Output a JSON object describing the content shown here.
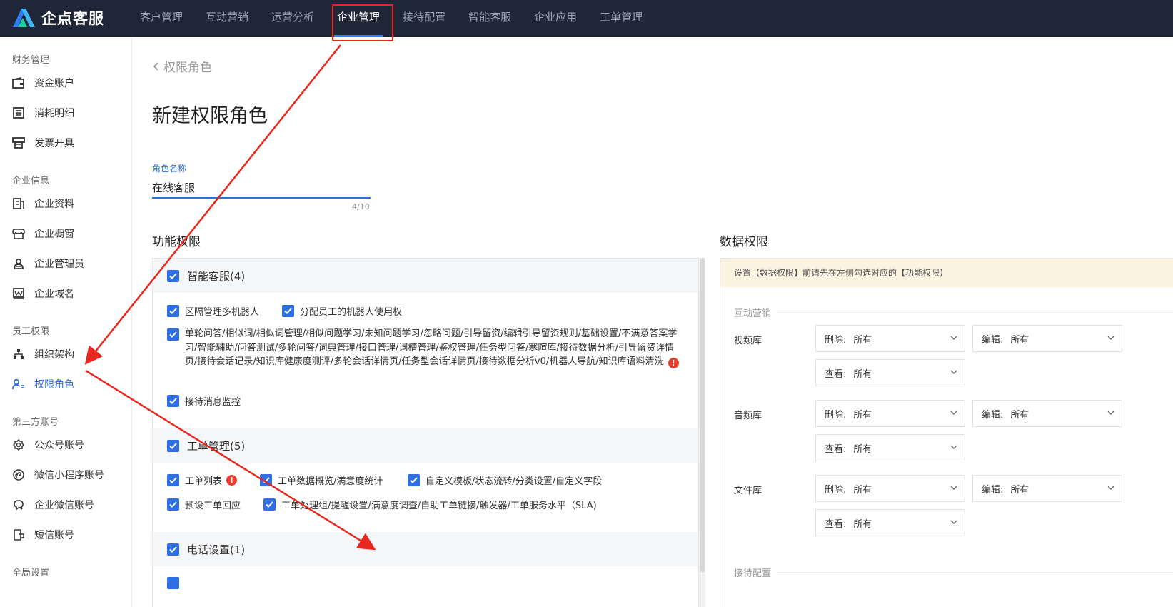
{
  "brand": {
    "name": "企点客服"
  },
  "nav": [
    {
      "label": "客户管理",
      "active": false
    },
    {
      "label": "互动营销",
      "active": false
    },
    {
      "label": "运营分析",
      "active": false
    },
    {
      "label": "企业管理",
      "active": true
    },
    {
      "label": "接待配置",
      "active": false
    },
    {
      "label": "智能客服",
      "active": false
    },
    {
      "label": "企业应用",
      "active": false
    },
    {
      "label": "工单管理",
      "active": false
    }
  ],
  "sidebar": {
    "groups": [
      {
        "title": "财务管理"
      },
      {
        "title": "企业信息"
      },
      {
        "title": "员工权限"
      },
      {
        "title": "第三方账号"
      },
      {
        "title": "全局设置"
      }
    ],
    "items": [
      {
        "label": "资金账户",
        "icon": "wallet-icon"
      },
      {
        "label": "消耗明细",
        "icon": "list-icon"
      },
      {
        "label": "发票开具",
        "icon": "invoice-icon"
      },
      {
        "label": "企业资料",
        "icon": "document-icon"
      },
      {
        "label": "企业橱窗",
        "icon": "storefront-icon"
      },
      {
        "label": "企业管理员",
        "icon": "user-icon"
      },
      {
        "label": "企业域名",
        "icon": "domain-icon"
      },
      {
        "label": "组织架构",
        "icon": "org-chart-icon"
      },
      {
        "label": "权限角色",
        "icon": "role-icon",
        "active": true
      },
      {
        "label": "公众号账号",
        "icon": "official-account-icon"
      },
      {
        "label": "微信小程序账号",
        "icon": "mini-program-icon"
      },
      {
        "label": "企业微信账号",
        "icon": "wecom-icon"
      },
      {
        "label": "短信账号",
        "icon": "sms-icon"
      }
    ]
  },
  "main": {
    "back_label": "权限角色",
    "title": "新建权限角色",
    "role_name": {
      "label": "角色名称",
      "value": "在线客服",
      "count": "4/10"
    },
    "func_title": "功能权限",
    "data_title": "数据权限"
  },
  "func_groups": [
    {
      "title": "智能客服(4)",
      "perms": [
        "区隔管理多机器人",
        "分配员工的机器人使用权",
        "单轮问答/相似词/相似词管理/相似问题学习/未知问题学习/忽略问题/引导留资/编辑引导留资规则/基础设置/不满意答案学习/智能辅助/问答测试/多轮问答/词典管理/接口管理/词槽管理/鉴权管理/任务型问答/寒暄库/接待数据分析/引导留资详情页/接待会话记录/知识库健康度测评/多轮会话详情页/任务型会话详情页/接待数据分析v0/机器人导航/知识库语料清洗",
        "接待消息监控"
      ]
    },
    {
      "title": "工单管理(5)",
      "perms": [
        "工单列表",
        "工单数据概览/满意度统计",
        "自定义模板/状态流转/分类设置/自定义字段",
        "预设工单回应",
        "工单处理组/提醒设置/满意度调查/自助工单链接/触发器/工单服务水平（SLA)"
      ]
    },
    {
      "title": "电话设置(1)"
    }
  ],
  "data_perm": {
    "notice": "设置【数据权限】前请先在左侧勾选对应的【功能权限】",
    "groups": [
      {
        "title": "互动营销"
      },
      {
        "title": "接待配置"
      }
    ],
    "rows": [
      {
        "label": "视频库",
        "delete": {
          "k": "删除:",
          "v": "所有"
        },
        "edit": {
          "k": "编辑:",
          "v": "所有"
        },
        "view": {
          "k": "查看:",
          "v": "所有"
        }
      },
      {
        "label": "音频库",
        "delete": {
          "k": "删除:",
          "v": "所有"
        },
        "edit": {
          "k": "编辑:",
          "v": "所有"
        },
        "view": {
          "k": "查看:",
          "v": "所有"
        }
      },
      {
        "label": "文件库",
        "delete": {
          "k": "删除:",
          "v": "所有"
        },
        "edit": {
          "k": "编辑:",
          "v": "所有"
        },
        "view": {
          "k": "查看:",
          "v": "所有"
        }
      }
    ]
  },
  "colors": {
    "primary": "#2f6fe4",
    "topbar": "#1f2637",
    "annotation": "#e8281f",
    "warning": "#e8402f",
    "notice_bg": "#fdf3e1"
  }
}
